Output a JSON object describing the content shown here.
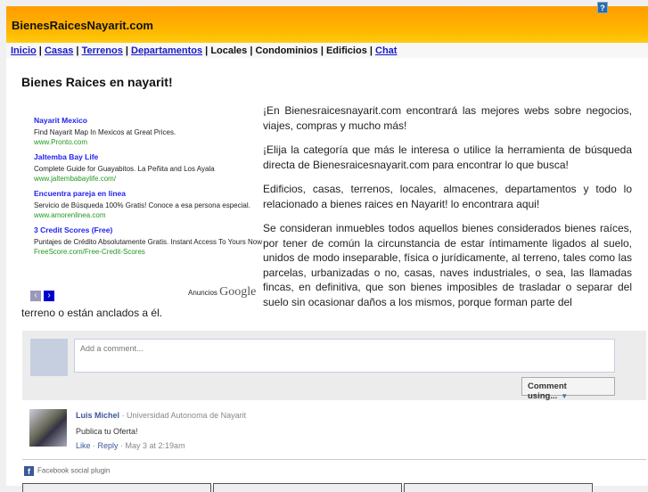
{
  "header": {
    "title": "BienesRaicesNayarit.com",
    "help_icon": "?"
  },
  "nav": [
    {
      "label": "Inicio",
      "link": true
    },
    {
      "label": "Casas",
      "link": true
    },
    {
      "label": "Terrenos",
      "link": true
    },
    {
      "label": "Departamentos",
      "link": true
    },
    {
      "label": "Locales",
      "link": false
    },
    {
      "label": "Condominios",
      "link": false
    },
    {
      "label": "Edificios",
      "link": false
    },
    {
      "label": "Chat",
      "link": true
    }
  ],
  "page": {
    "heading": "Bienes Raices en nayarit!"
  },
  "ads": {
    "items": [
      {
        "title": "Nayarit Mexico",
        "desc": "Find Nayarit Map In Mexicos at Great Prices.",
        "url": "www.Pronto.com"
      },
      {
        "title": "Jaltemba Bay Life",
        "desc": "Complete Guide for Guayabitos. La Peñita and Los Ayala",
        "url": "www.jaltembabaylife.com/"
      },
      {
        "title": "Encuentra pareja en linea",
        "desc": "Servicio de Búsqueda 100% Gratis! Conoce a esa persona especial.",
        "url": "www.amorenlinea.com"
      },
      {
        "title": "3 Credit Scores (Free)",
        "desc": "Puntajes de Crédito Absolutamente Gratis. Instant Access To Yours Now",
        "url": "FreeScore.com/Free-Credit-Scores"
      }
    ],
    "prev": "‹",
    "next": "›",
    "label": "Anuncios",
    "brand": "Google"
  },
  "body": {
    "paragraphs": [
      "¡En Bienesraicesnayarit.com encontrará las mejores webs sobre negocios, viajes, compras y mucho más!",
      "¡Elija la categoría que más le interesa o utilice la herramienta de búsqueda directa de Bienesraicesnayarit.com para encontrar lo que busca!",
      "Edificios, casas, terrenos, locales, almacenes, departamentos y todo lo relacionado a bienes raices en Nayarit! lo encontrara aqui!",
      "Se consideran inmuebles todos aquellos bienes considerados bienes raíces, por tener de común la circunstancia de estar íntimamente ligados al suelo, unidos de modo inseparable, física o jurídicamente, al terreno, tales como las parcelas, urbanizadas o no, casas, naves industriales, o sea, las llamadas fincas, en definitiva, que son bienes imposibles de trasladar o separar del suelo sin ocasionar daños a los mismos, porque forman parte del"
    ],
    "tail": "terreno o están anclados a él."
  },
  "comments": {
    "placeholder": "Add a comment...",
    "comment_using": "Comment using...",
    "arrow": "▼",
    "item": {
      "author": "Luis Michel",
      "affiliation": " · Universidad Autonoma de Nayarit",
      "text": "Publica tu Oferta!",
      "like": "Like",
      "reply": "Reply",
      "time": " · May 3 at 2:19am",
      "sep": " · "
    },
    "plugin": "Facebook social plugin",
    "fb": "f"
  }
}
